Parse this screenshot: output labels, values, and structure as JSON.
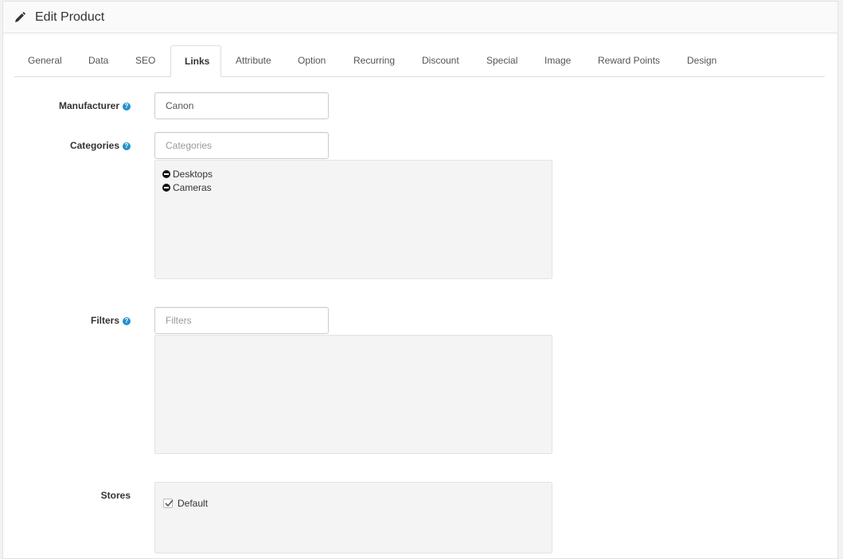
{
  "header": {
    "title": "Edit Product",
    "icon": "pencil-icon"
  },
  "tabs": [
    {
      "label": "General",
      "active": false
    },
    {
      "label": "Data",
      "active": false
    },
    {
      "label": "SEO",
      "active": false
    },
    {
      "label": "Links",
      "active": true
    },
    {
      "label": "Attribute",
      "active": false
    },
    {
      "label": "Option",
      "active": false
    },
    {
      "label": "Recurring",
      "active": false
    },
    {
      "label": "Discount",
      "active": false
    },
    {
      "label": "Special",
      "active": false
    },
    {
      "label": "Image",
      "active": false
    },
    {
      "label": "Reward Points",
      "active": false
    },
    {
      "label": "Design",
      "active": false
    }
  ],
  "form": {
    "manufacturer": {
      "label": "Manufacturer",
      "value": "Canon",
      "help_icon": "question-circle-icon"
    },
    "categories": {
      "label": "Categories",
      "placeholder": "Categories",
      "help_icon": "question-circle-icon",
      "items": [
        "Desktops",
        "Cameras"
      ]
    },
    "filters": {
      "label": "Filters",
      "placeholder": "Filters",
      "help_icon": "question-circle-icon",
      "items": []
    },
    "stores": {
      "label": "Stores",
      "items": [
        {
          "label": "Default",
          "checked": true
        }
      ]
    }
  },
  "colors": {
    "help_icon": "#1e91cf",
    "well_bg": "#f4f4f4"
  }
}
